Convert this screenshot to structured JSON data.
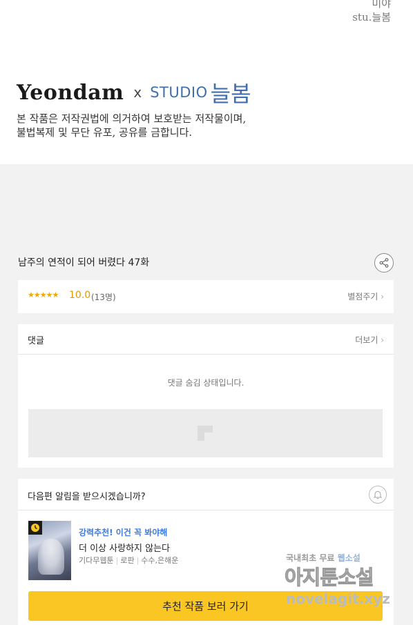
{
  "header": {
    "credit_line1": "미야",
    "credit_line2": "stu.늘봄",
    "logo_publisher": "Yeondam",
    "logo_x": "x",
    "logo_studio": "STUDIO",
    "logo_studio_korean": "늘봄",
    "copyright_line1": "본 작품은 저작권법에 의거하여 보호받는 저작물이며,",
    "copyright_line2": "불법복제 및 무단 유포, 공유를 금합니다."
  },
  "episode": {
    "title": "남주의 연적이 되어 버렸다 47화",
    "share_icon": "share-icon"
  },
  "rating": {
    "stars": "★★★★★",
    "score": "10.0",
    "count": "(13명)",
    "rate_link": "별점주기",
    "accent_color": "#f0a800"
  },
  "comments": {
    "title": "댓글",
    "more_link": "더보기",
    "hidden_message": "댓글 숨김 상태입니다."
  },
  "recommend": {
    "question": "다음편 알림을 받으시겠습니까?",
    "bell_icon": "bell-icon",
    "tag": "강력추천! 이건 꼭 봐야해",
    "tag_color": "#3d7be0",
    "title": "더 이상 사랑하지 않는다",
    "meta": [
      "기다무웹툰",
      "로판",
      "수수,은해운"
    ],
    "button": "추천 작품 보러 가기",
    "button_color": "#f9c623"
  },
  "watermark": {
    "line1_a": "국내최초 무료 ",
    "line1_b": "웹소설",
    "line2": "아지툰소설",
    "line3": "novelagit.xyz"
  }
}
